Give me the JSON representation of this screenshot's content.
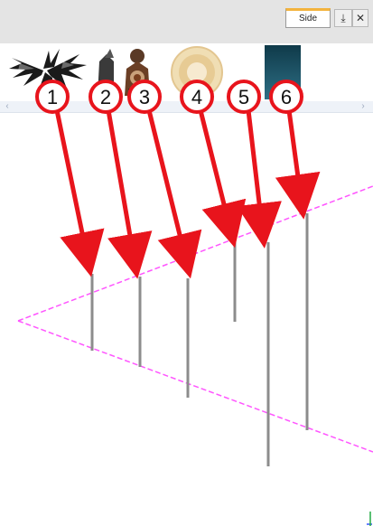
{
  "toolbar": {
    "tab_label": "Side",
    "pin_icon": "pin-icon",
    "close_icon": "close-icon"
  },
  "thumbnails": [
    {
      "name": "palm-plant-thumbnail"
    },
    {
      "name": "figures-thumbnail"
    },
    {
      "name": "dish-thumbnail"
    },
    {
      "name": "teal-panel-thumbnail"
    }
  ],
  "scrollbar": {
    "left_icon": "chevron-left-icon",
    "right_icon": "chevron-right-icon"
  },
  "callouts": [
    "1",
    "2",
    "3",
    "4",
    "5",
    "6"
  ],
  "colors": {
    "callout_red": "#e8141c",
    "guide_magenta": "#ff55ff",
    "bar_gray": "#8c8c8c",
    "tab_accent": "#f3b33d"
  }
}
